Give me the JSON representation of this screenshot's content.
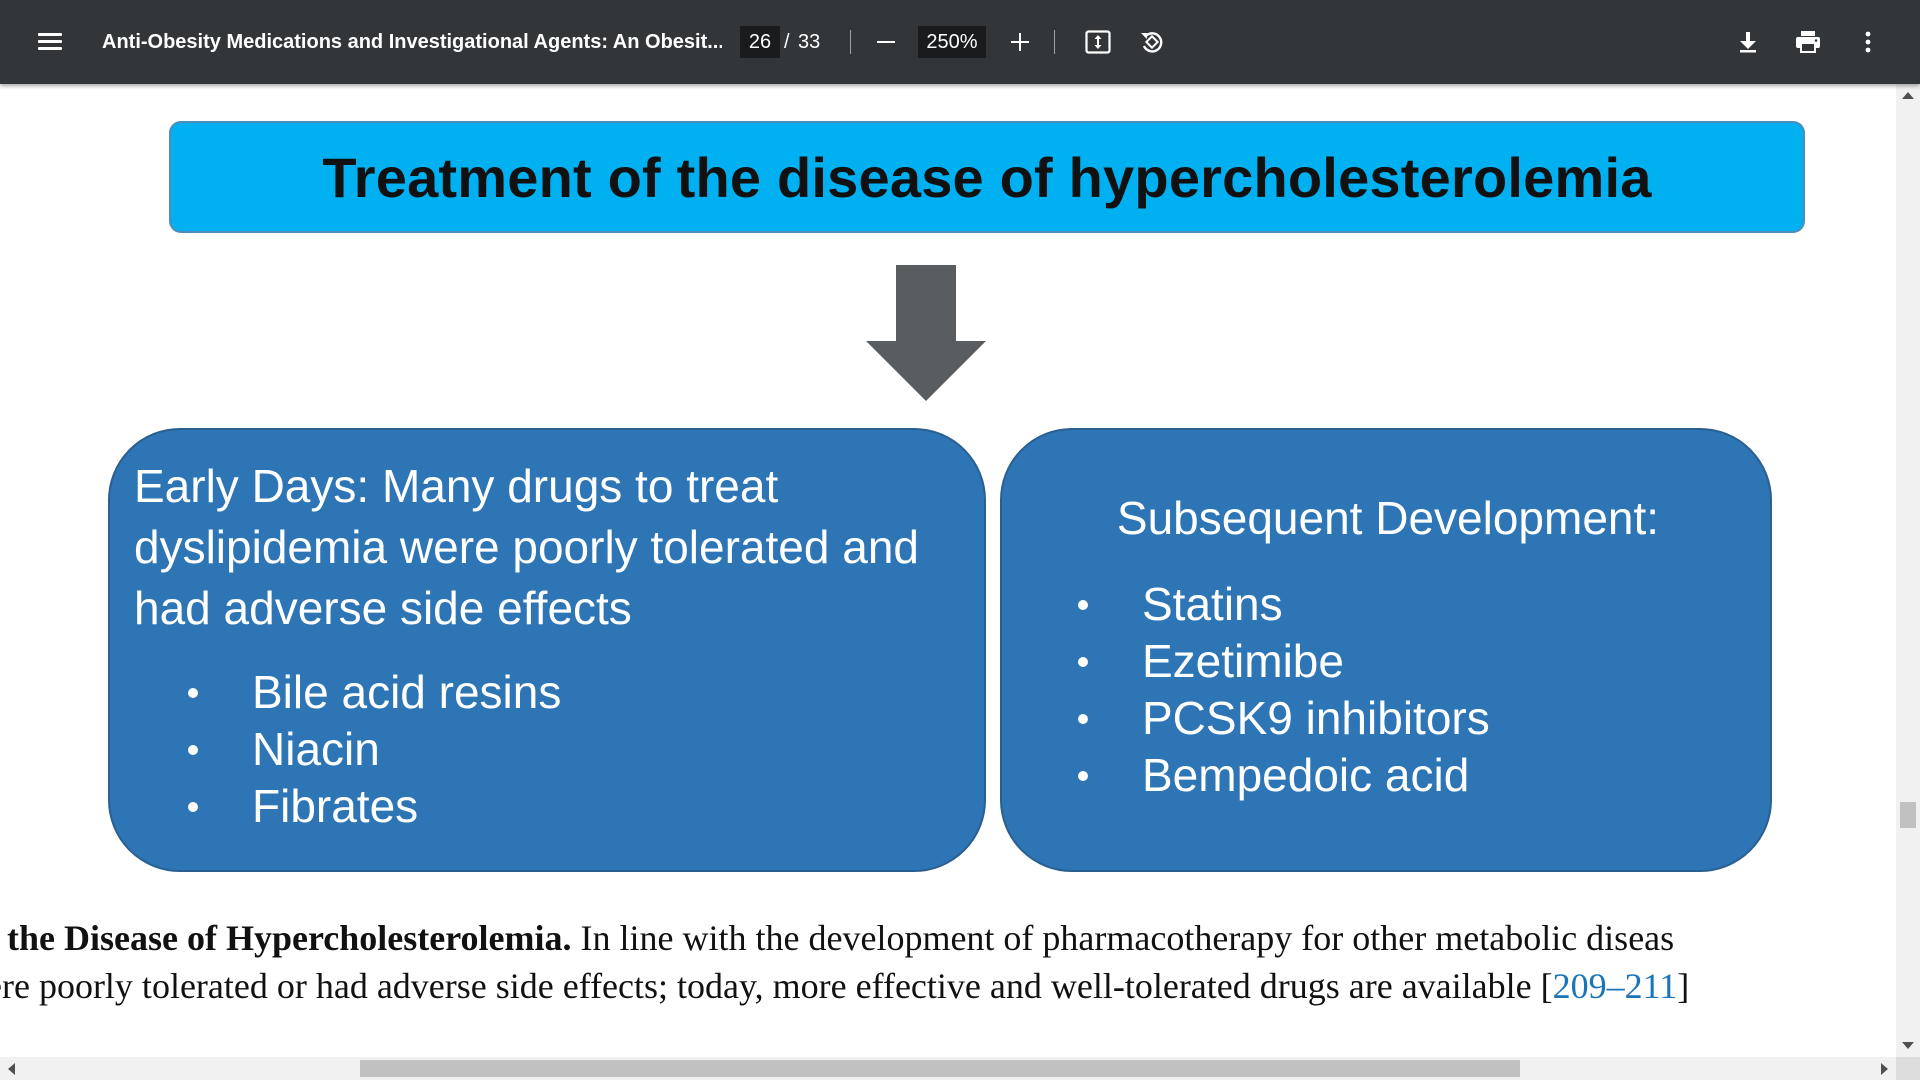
{
  "toolbar": {
    "title": "Anti-Obesity Medications and Investigational Agents: An Obesit...",
    "page_current": "26",
    "page_separator": "/",
    "page_total": "33",
    "zoom": "250%",
    "icons": {
      "menu": "menu-icon",
      "zoom_out": "minus-icon",
      "zoom_in": "plus-icon",
      "fit": "fit-to-page-icon",
      "rotate": "rotate-icon",
      "download": "download-icon",
      "print": "print-icon",
      "more": "more-vertical-icon"
    }
  },
  "figure": {
    "title": "Treatment of the disease of hypercholesterolemia",
    "left_panel": {
      "heading": "Early Days: Many drugs to treat dyslipidemia were poorly tolerated and had adverse side effects",
      "items": [
        "Bile acid resins",
        "Niacin",
        "Fibrates"
      ]
    },
    "right_panel": {
      "heading": "Subsequent Development:",
      "items": [
        "Statins",
        "Ezetimibe",
        "PCSK9 inhibitors",
        "Bempedoic acid"
      ]
    },
    "colors": {
      "title_box": "#00b0f0",
      "panel": "#2e75b6",
      "arrow": "#595d60"
    }
  },
  "body": {
    "line1_bold": "f the Disease of Hypercholesterolemia.",
    "line1_rest": " In line with the development of pharmacotherapy for other metabolic diseas",
    "line2_text": "ere poorly tolerated or had adverse side effects; today, more effective and well-tolerated drugs are available [",
    "line2_ref": "209–211",
    "line2_end": "]"
  }
}
